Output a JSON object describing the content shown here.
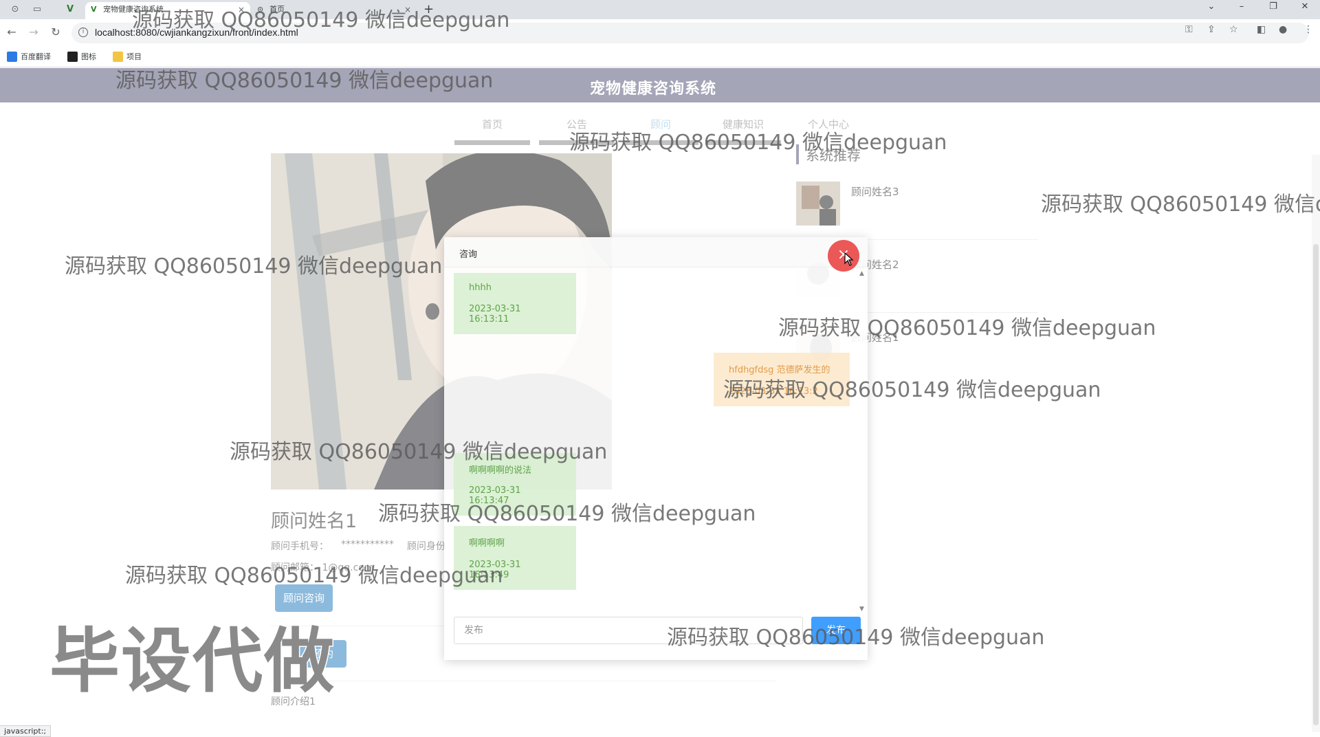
{
  "browser": {
    "tabs": [
      {
        "label": "宠物健康咨询系统",
        "close": "×"
      },
      {
        "label": "首页",
        "close": "×"
      }
    ],
    "newtab": "+",
    "url": "localhost:8080/cwjiankangzixun/front/index.html",
    "bookmarks": [
      {
        "label": "百度翻译",
        "icon": "baidu-translate-icon",
        "color": "#2c7be5"
      },
      {
        "label": "图标",
        "icon": "image-icon",
        "color": "#222222"
      },
      {
        "label": "项目",
        "icon": "folder-icon",
        "color": "#f2c542"
      }
    ],
    "status_text": "javascript:;"
  },
  "site": {
    "title": "宠物健康咨询系统",
    "header_color": "#5b5c7f",
    "nav": [
      {
        "label": "首页",
        "active": false
      },
      {
        "label": "公告",
        "active": false
      },
      {
        "label": "顾问",
        "active": true
      },
      {
        "label": "健康知识",
        "active": false
      },
      {
        "label": "个人中心",
        "active": false
      }
    ]
  },
  "consultant": {
    "name": "顾问姓名1",
    "phone_label": "顾问手机号：",
    "phone_value": "***********",
    "id_label": "顾问身份",
    "email_label": "顾问邮箱：",
    "email_value": "1@qq.com",
    "consult_button": "顾问咨询",
    "appointment_button": "预约",
    "intro": "顾问介绍1"
  },
  "ranking": {
    "title": "系统推荐",
    "items": [
      {
        "name": "顾问姓名3"
      },
      {
        "name": "顾问姓名2"
      },
      {
        "name": "顾问姓名1"
      }
    ]
  },
  "dialog": {
    "title": "咨询",
    "close": "×",
    "messages": [
      {
        "side": "left",
        "text": "hhhh",
        "time": "2023-03-31 16:13:11"
      },
      {
        "side": "right",
        "text": "hfdhgfdsg 范德萨发生的",
        "time": "2023-03-31 16:13:2"
      },
      {
        "side": "left",
        "text": "啊啊啊啊的说法",
        "time": "2023-03-31 16:13:47"
      },
      {
        "side": "left",
        "text": "啊啊啊啊",
        "time": "2023-03-31 16:13:49"
      }
    ],
    "input_placeholder": "发布",
    "send_button": "发布",
    "accent": "#409eff"
  },
  "watermarks": {
    "qq": "源码获取 QQ86050149 微信deepguan",
    "qq_partial": "源码获取 QQ86050149 微信d",
    "big": "毕设代做"
  }
}
